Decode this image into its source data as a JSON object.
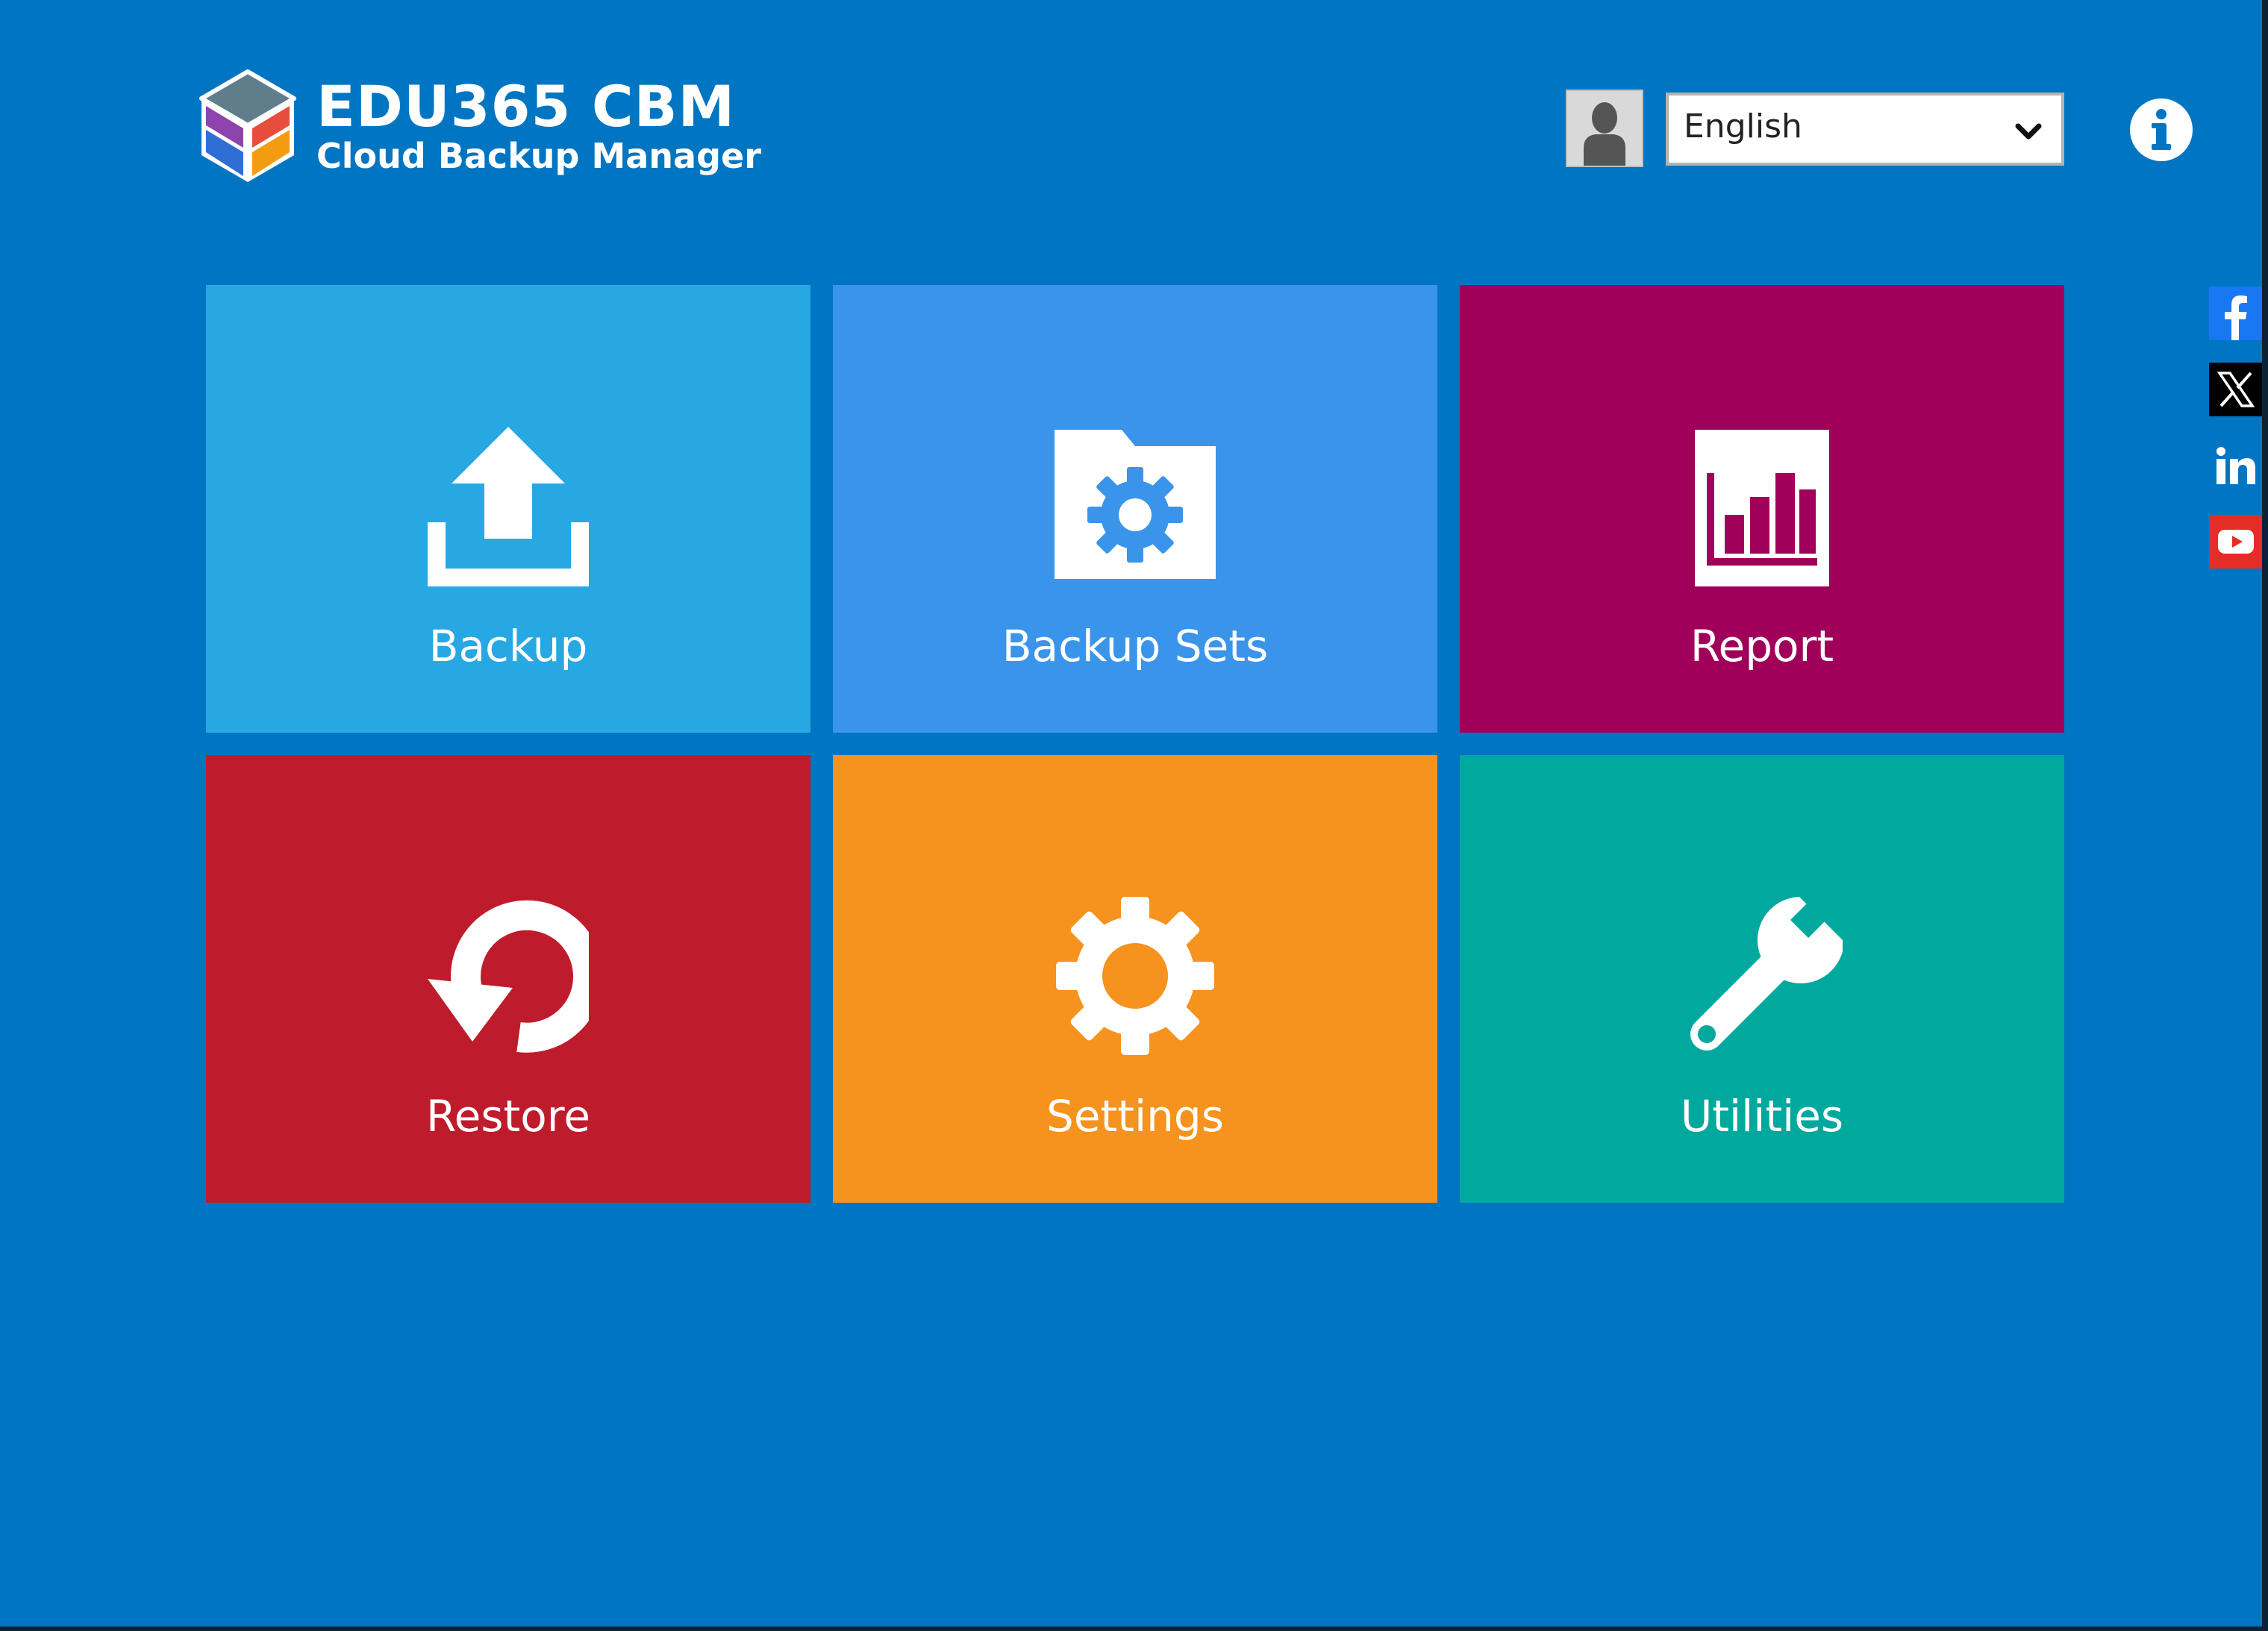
{
  "brand": {
    "title": "EDU365 CBM",
    "subtitle": "Cloud Backup Manager"
  },
  "header": {
    "language": {
      "selected": "English"
    },
    "avatar_icon": "user-silhouette-icon",
    "info_icon": "info-icon"
  },
  "tiles": [
    {
      "label": "Backup",
      "icon": "upload-icon",
      "color": "#27a8e3"
    },
    {
      "label": "Backup Sets",
      "icon": "folder-gear-icon",
      "color": "#3a95ea"
    },
    {
      "label": "Report",
      "icon": "bar-chart-icon",
      "color": "#a1005a"
    },
    {
      "label": "Restore",
      "icon": "undo-arrow-icon",
      "color": "#be1c2c"
    },
    {
      "label": "Settings",
      "icon": "gear-icon",
      "color": "#f6921e"
    },
    {
      "label": "Utilities",
      "icon": "wrench-icon",
      "color": "#00a89d"
    }
  ],
  "social": [
    {
      "icon": "facebook-icon",
      "color": "#1877f2"
    },
    {
      "icon": "x-twitter-icon",
      "color": "#000000"
    },
    {
      "icon": "linkedin-icon",
      "color": "#0a66c2"
    },
    {
      "icon": "youtube-icon",
      "color": "#e52d27"
    }
  ],
  "colors": {
    "background": "#0075c2"
  }
}
